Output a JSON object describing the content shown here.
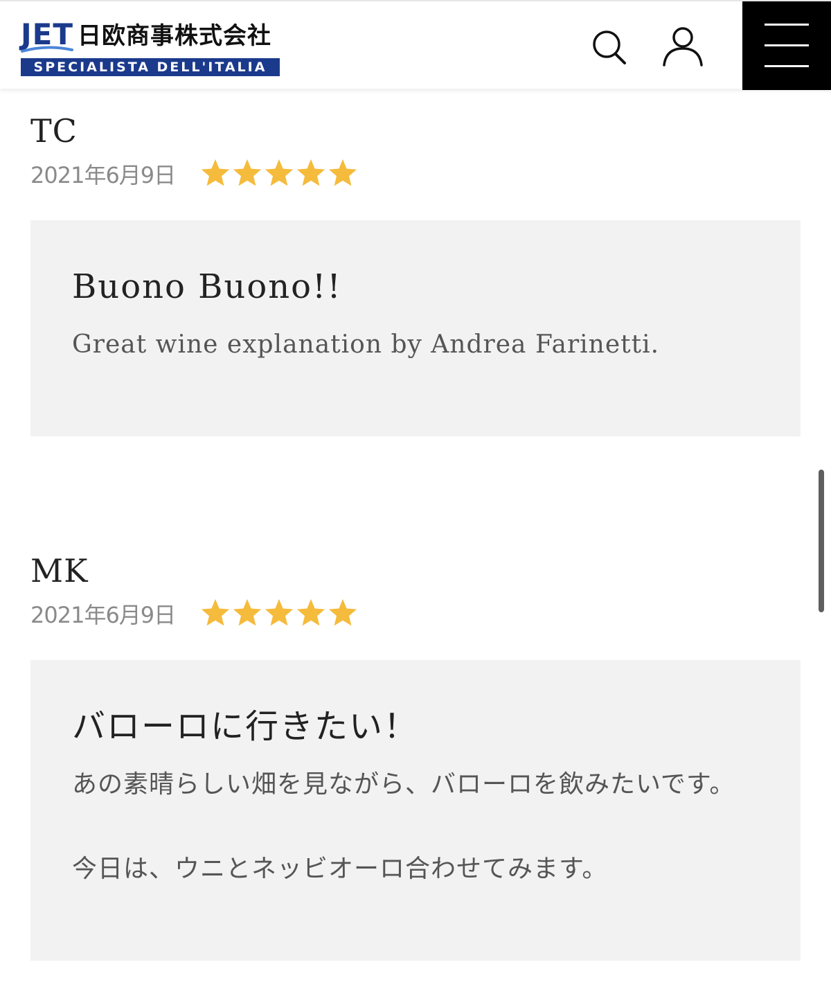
{
  "header": {
    "logo_mark": "JET",
    "company_name": "日欧商事株式会社",
    "tagline": "SPECIALISTA DELL'ITALIA",
    "brand_color": "#1b3a8c",
    "search_icon": "search-icon",
    "user_icon": "user-icon",
    "menu_icon": "hamburger-menu-icon"
  },
  "star_color": "#f5bb3c",
  "reviews": [
    {
      "name": "TC",
      "date": "2021年6月9日",
      "rating": 5,
      "title": "Buono Buono!!",
      "body": [
        "Great wine explanation by Andrea Farinetti."
      ]
    },
    {
      "name": "MK",
      "date": "2021年6月9日",
      "rating": 5,
      "title": "バローロに行きたい！",
      "body": [
        "あの素晴らしい畑を見ながら、バローロを飲みたいです。",
        "今日は、ウニとネッビオーロ合わせてみます。"
      ]
    }
  ]
}
